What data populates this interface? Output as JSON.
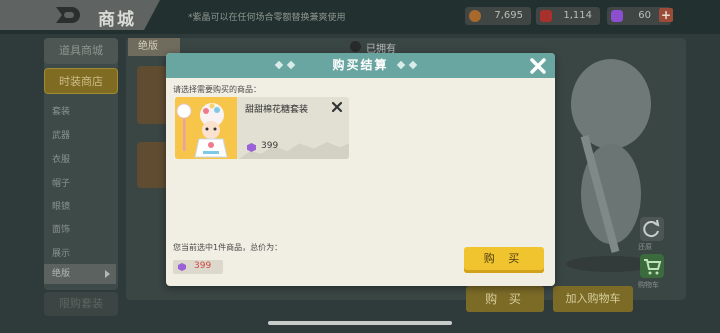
{
  "header": {
    "title": "商城",
    "note": "*紫晶可以在任何场合零额替换兼爽使用"
  },
  "currencies": [
    {
      "name": "coin",
      "value": "7,695",
      "color": "#a8692c"
    },
    {
      "name": "ticket",
      "value": "1,114",
      "color": "#a8322b"
    },
    {
      "name": "gem",
      "value": "60",
      "color": "#8c4fcf",
      "add_label": "+"
    }
  ],
  "sidebar": {
    "items": [
      {
        "label": "道具商城"
      },
      {
        "label": "时装商店"
      },
      {
        "label": "套装"
      },
      {
        "label": "武器"
      },
      {
        "label": "衣服"
      },
      {
        "label": "帽子"
      },
      {
        "label": "眼镜"
      },
      {
        "label": "面饰"
      },
      {
        "label": "展示"
      },
      {
        "label": "绝版"
      }
    ],
    "bottom_button": "限购套装"
  },
  "content": {
    "tab_label": "绝版",
    "owned_label": "已拥有"
  },
  "bottom_actions": {
    "buy": "购 买",
    "add_to_cart": "加入购物车",
    "restore_label": "还原",
    "cart_label": "购物车"
  },
  "modal": {
    "title": "购买结算",
    "prompt": "请选择需要购买的商品：",
    "product": {
      "name": "甜甜棉花糖套装",
      "price": "399",
      "currency_icon": "purple-gem-icon"
    },
    "total_label": "您当前选中1件商品，总价为：",
    "total_value": "399",
    "buy_button": "购 买"
  },
  "colors": {
    "modal_header": "#6aa6a1",
    "modal_body": "#f1efe3",
    "buy_button": "#f0c42e",
    "total_price": "#d04545",
    "gem": "#9b62d7"
  }
}
